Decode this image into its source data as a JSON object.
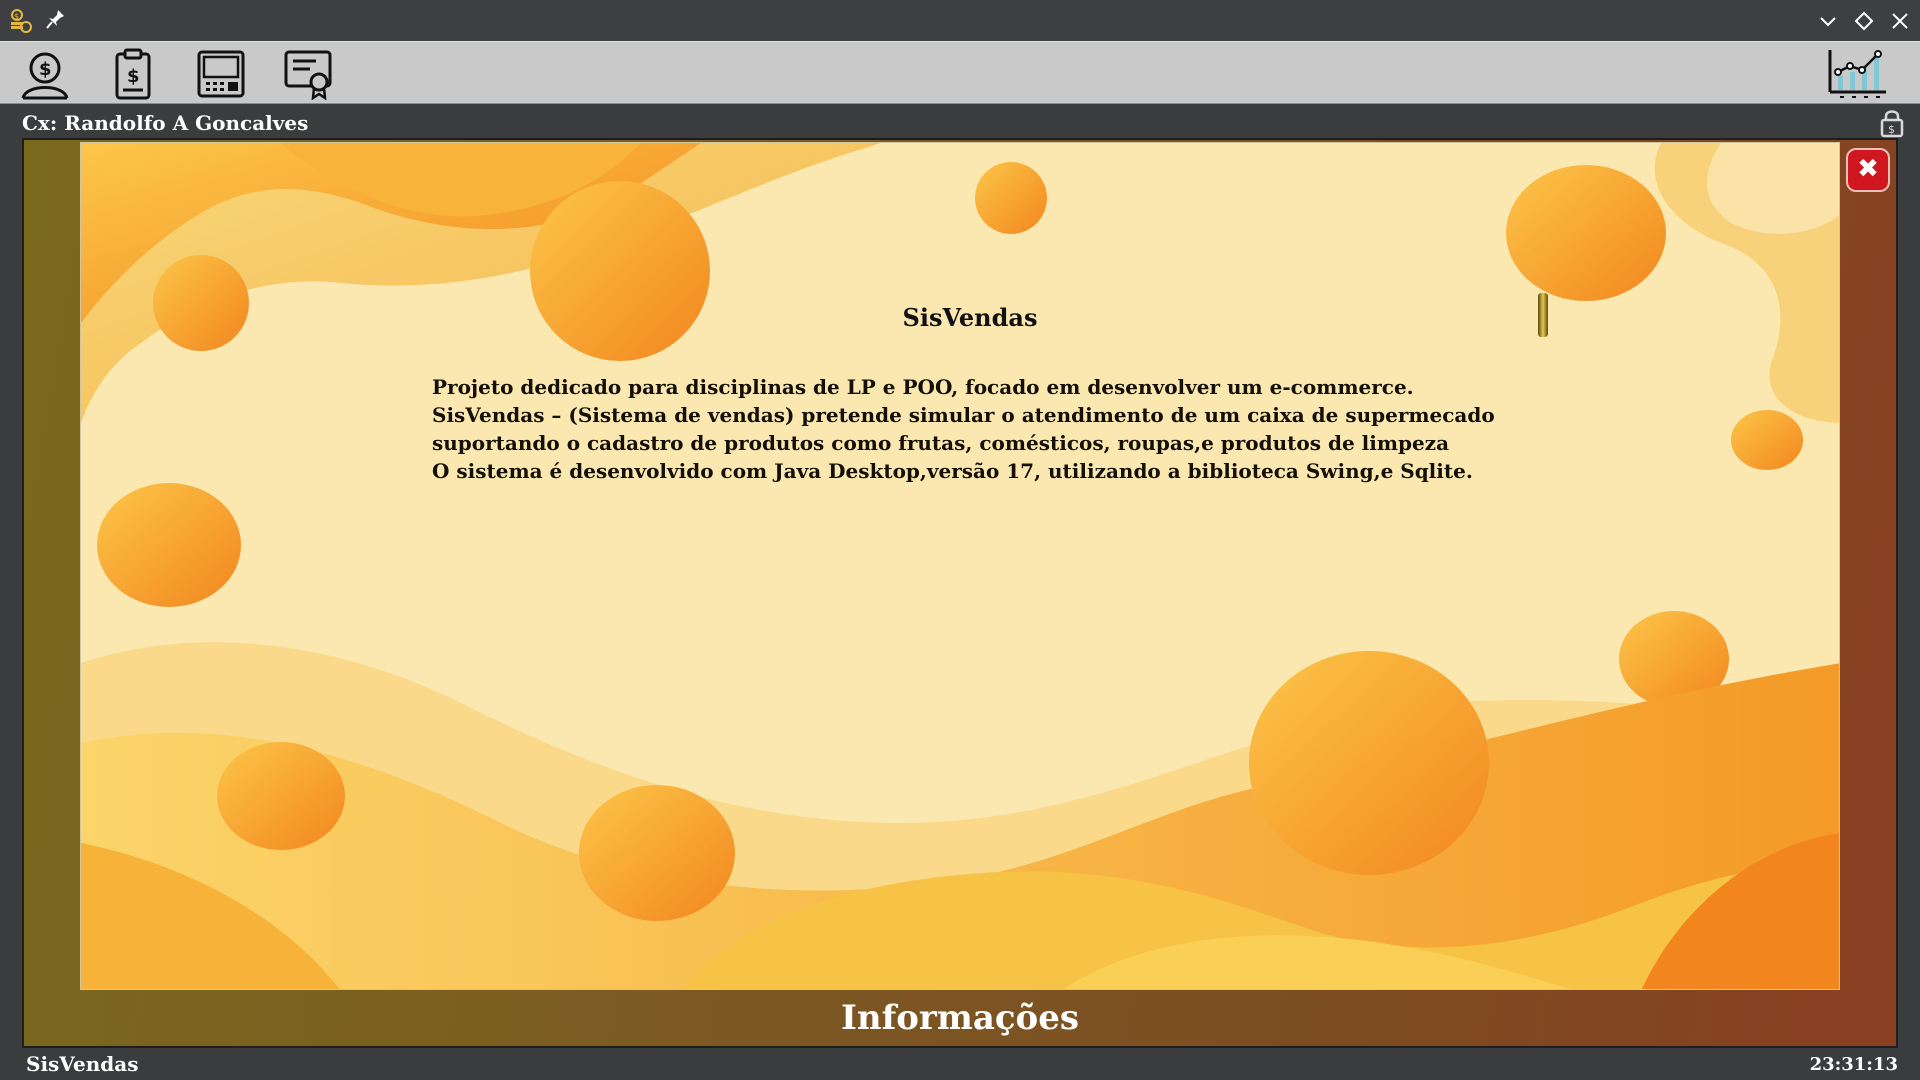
{
  "window": {
    "icons": [
      "coins-icon",
      "pin-icon"
    ],
    "controls": [
      "minimize-icon",
      "maximize-icon",
      "close-icon"
    ]
  },
  "toolbar": {
    "tools": [
      "cashier-user-icon",
      "sales-clipboard-icon",
      "pos-terminal-icon",
      "certificate-icon"
    ],
    "right_tool": "line-chart-icon"
  },
  "session": {
    "cashier_label": "Cx: Randolfo A Goncalves",
    "lock_icon": "money-lock-icon"
  },
  "info_window": {
    "caption": "Informações",
    "title": "SisVendas",
    "lines": [
      "Projeto dedicado para disciplinas de LP e POO, focado em desenvolver um e-commerce.",
      "SisVendas – (Sistema de vendas) pretende simular o atendimento de um caixa de supermecado",
      "suportando o cadastro de produtos como frutas, comésticos, roupas,e produtos de limpeza",
      "O sistema é desenvolvido com Java Desktop,versão 17, utilizando a biblioteca Swing,e Sqlite."
    ],
    "close_symbol": "✖"
  },
  "status": {
    "app_name": "SisVendas",
    "clock": "23:31:13"
  },
  "colors": {
    "accent_close": "#d0161f",
    "background_cream": "#fbe8b0",
    "blob_orange": "#f39c24"
  }
}
